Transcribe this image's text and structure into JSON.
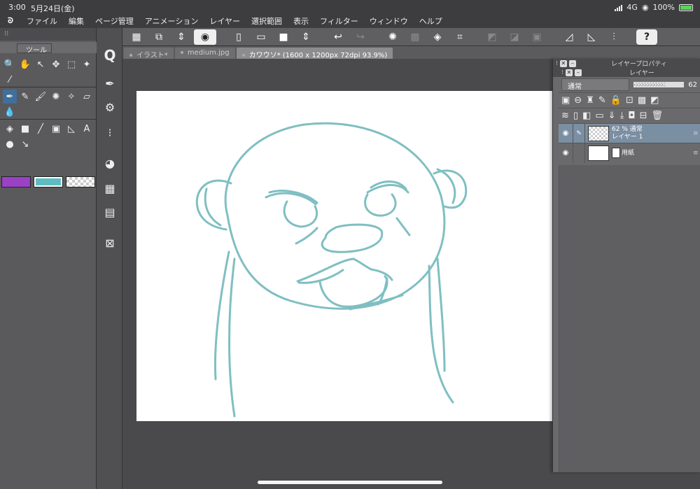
{
  "status": {
    "time": "3:00",
    "date": "5月24日(金)",
    "network": "4G",
    "battery": "100%"
  },
  "menu": [
    "ファイル",
    "編集",
    "ページ管理",
    "アニメーション",
    "レイヤー",
    "選択範囲",
    "表示",
    "フィルター",
    "ウィンドウ",
    "ヘルプ"
  ],
  "tool_panel": {
    "title": "ツール"
  },
  "tabs": [
    {
      "label": "イラスト*"
    },
    {
      "label": "medium.jpg"
    },
    {
      "label": "カワウソ* (1600 x 1200px 72dpi 93.9%)"
    }
  ],
  "layer_property": {
    "title": "レイヤープロパティ"
  },
  "layer_panel": {
    "title": "レイヤー",
    "blend_mode": "通常",
    "opacity_label": "62",
    "opacity_fraction": 0.62,
    "layers": [
      {
        "line1": "62 % 通常",
        "line2": "レイヤー 1"
      },
      {
        "line1": "用紙"
      }
    ]
  },
  "colors": {
    "main": "#9b41c6",
    "sub": "#5ebcc0",
    "sketch": "#7fbfc2"
  }
}
